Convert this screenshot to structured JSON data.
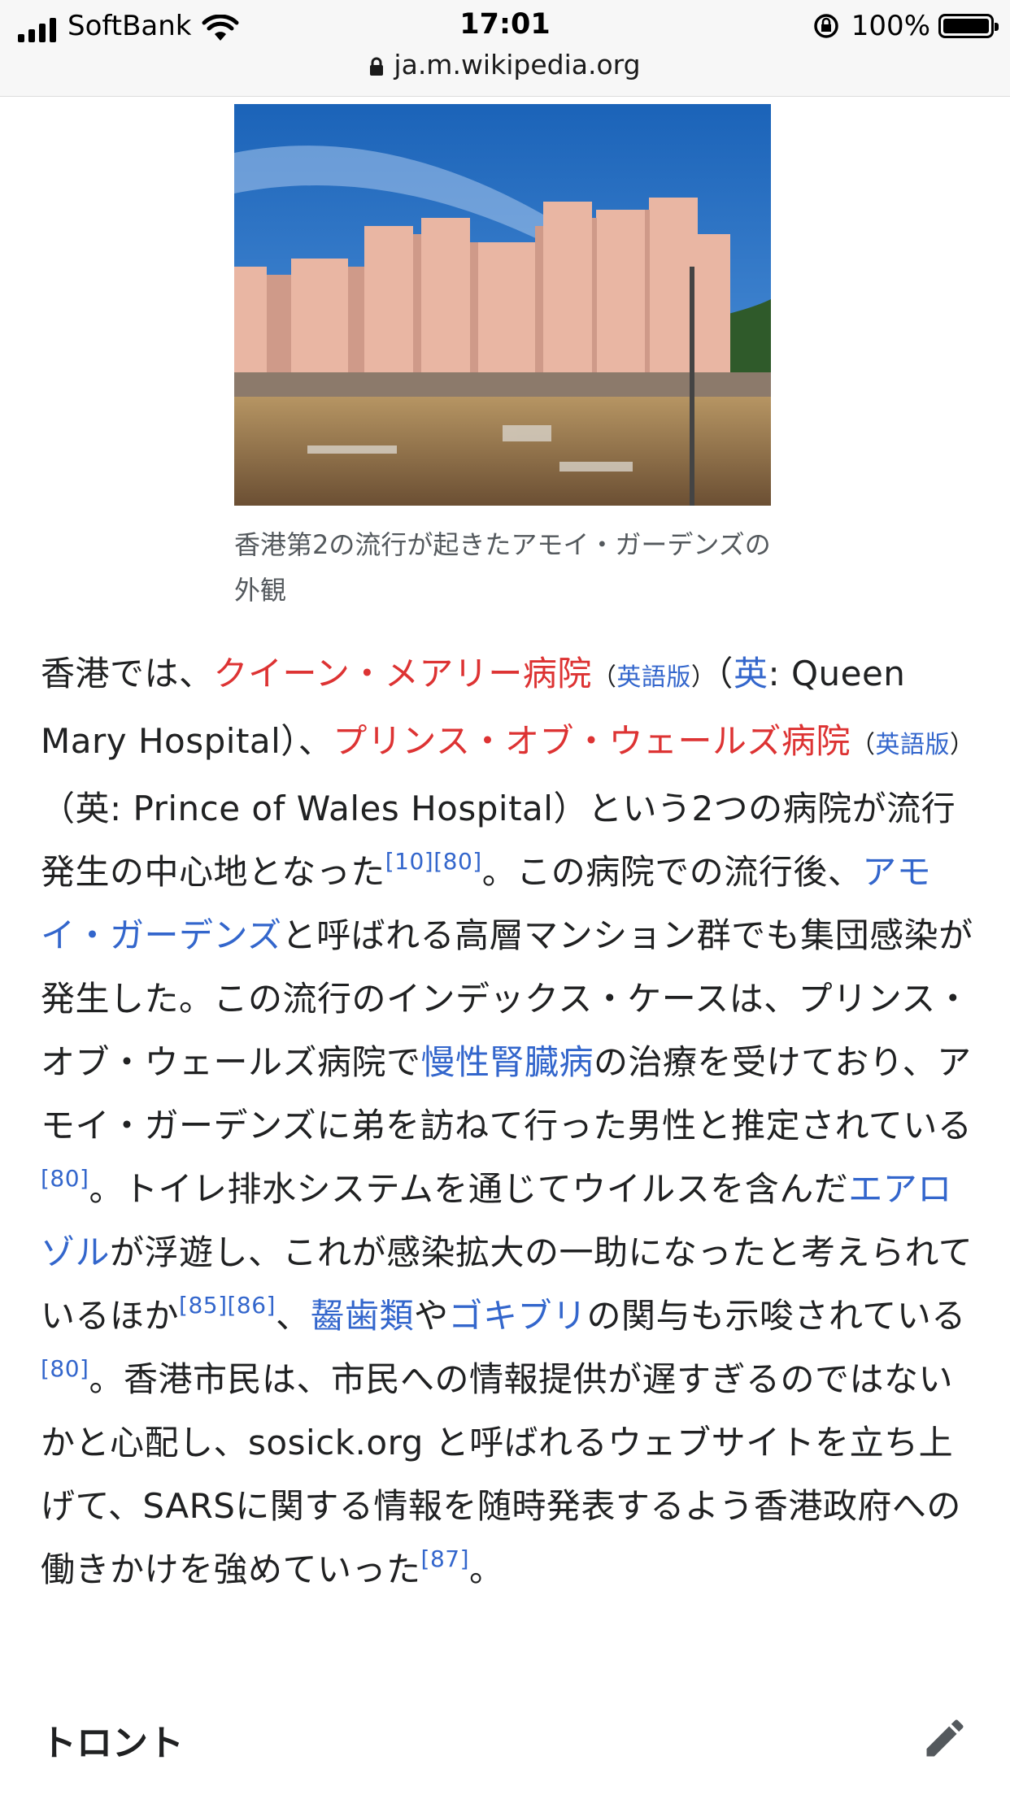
{
  "status_bar": {
    "carrier": "SoftBank",
    "time": "17:01",
    "battery": "100%",
    "url": "ja.m.wikipedia.org"
  },
  "figure": {
    "caption": "香港第2の流行が起きたアモイ・ガーデンズの外観"
  },
  "paragraph": {
    "t1": "香港では、",
    "link_qmh": "クイーン・メアリー病院",
    "en_version_1": "英語版",
    "t2": "（",
    "link_ei1": "英",
    "t3": ": Queen Mary Hospital）、",
    "link_pwh": "プリンス・オブ・ウェールズ病院",
    "en_version_2": "英語版",
    "t4": "（英: Prince of Wales Hospital）という2つの病院が流行発生の中心地となった",
    "ref1": "[10][80]",
    "t5": "。この病院での流行後、",
    "link_amoy": "アモイ・ガーデンズ",
    "t6": "と呼ばれる高層マンション群でも集団感染が発生した。この流行のインデックス・ケースは、プリンス・オブ・ウェールズ病院で",
    "link_ckd": "慢性腎臓病",
    "t7": "の治療を受けており、アモイ・ガーデンズに弟を訪ねて行った男性と推定されている",
    "ref2": "[80]",
    "t8": "。トイレ排水システムを通じてウイルスを含んだ",
    "link_aerosol": "エアロゾル",
    "t9": "が浮遊し、これが感染拡大の一助になったと考えられているほか",
    "ref3": "[85][86]",
    "t10": "、",
    "link_rodent": "齧歯類",
    "t11": "や",
    "link_cockroach": "ゴキブリ",
    "t12": "の関与も示唆されている",
    "ref4": "[80]",
    "t13": "。香港市民は、市民への情報提供が遅すぎるのではないかと心配し、sosick.org と呼ばれるウェブサイトを立ち上げて、SARSに関する情報を随時発表するよう香港政府への働きかけを強めていった",
    "ref5": "[87]",
    "t14": "。"
  },
  "section": {
    "heading": "トロント"
  }
}
